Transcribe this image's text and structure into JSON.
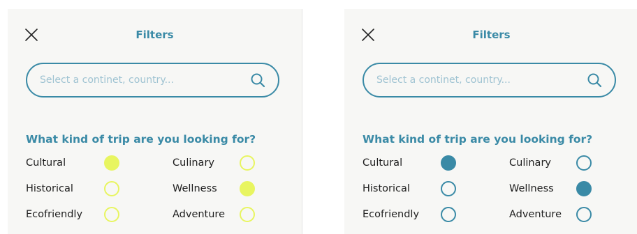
{
  "colors": {
    "accent": "#3a8aa6",
    "variant_a_radio": "#e8f560",
    "variant_b_radio": "#3a8aa6",
    "panel_background": "#f7f7f5"
  },
  "panels": [
    {
      "variant": "lime",
      "title": "Filters",
      "close_icon": "close-icon",
      "search": {
        "placeholder": "Select a continet, country...",
        "value": "",
        "icon": "search-icon"
      },
      "question": "What kind of trip are you looking for?",
      "options": [
        {
          "label": "Cultural",
          "checked": true
        },
        {
          "label": "Culinary",
          "checked": false
        },
        {
          "label": "Historical",
          "checked": false
        },
        {
          "label": "Wellness",
          "checked": true
        },
        {
          "label": "Ecofriendly",
          "checked": false
        },
        {
          "label": "Adventure",
          "checked": false
        }
      ]
    },
    {
      "variant": "teal",
      "title": "Filters",
      "close_icon": "close-icon",
      "search": {
        "placeholder": "Select a continet, country...",
        "value": "",
        "icon": "search-icon"
      },
      "question": "What kind of trip are you looking for?",
      "options": [
        {
          "label": "Cultural",
          "checked": true
        },
        {
          "label": "Culinary",
          "checked": false
        },
        {
          "label": "Historical",
          "checked": false
        },
        {
          "label": "Wellness",
          "checked": true
        },
        {
          "label": "Ecofriendly",
          "checked": false
        },
        {
          "label": "Adventure",
          "checked": false
        }
      ]
    }
  ]
}
